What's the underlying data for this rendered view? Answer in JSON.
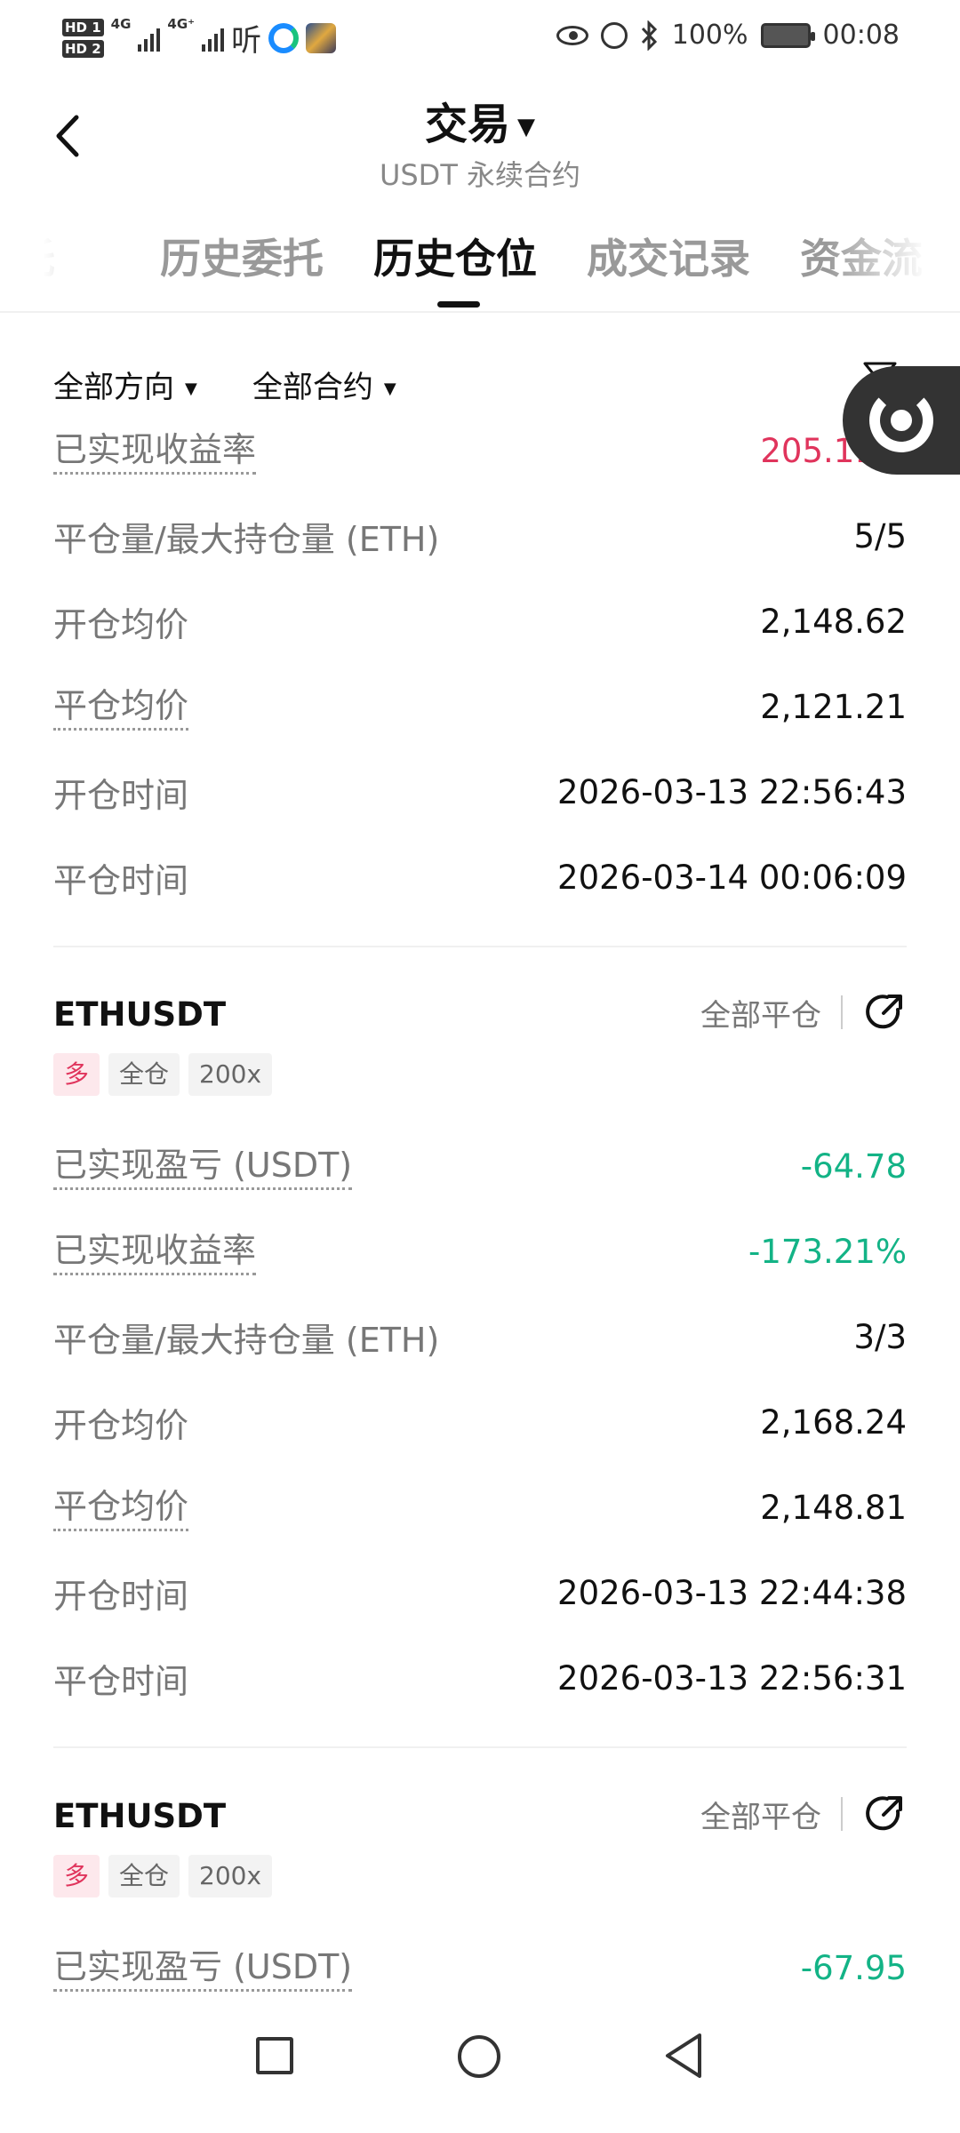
{
  "status_bar": {
    "hd1": "HD 1",
    "hd2": "HD 2",
    "net1": "4G",
    "net2": "4G⁺",
    "app_text": "听",
    "battery_pct": "100%",
    "time": "00:08"
  },
  "header": {
    "title": "交易",
    "subtitle": "USDT 永续合约"
  },
  "tabs": [
    {
      "label": "委托"
    },
    {
      "label": "历史委托"
    },
    {
      "label": "历史仓位",
      "active": true
    },
    {
      "label": "成交记录"
    },
    {
      "label": "资金流"
    }
  ],
  "filters": {
    "direction": "全部方向",
    "contract": "全部合约"
  },
  "card0": {
    "rows": [
      {
        "label": "已实现收益率",
        "value": "205.11%"
      },
      {
        "label": "平仓量/最大持仓量 (ETH)",
        "value": "5/5"
      },
      {
        "label": "开仓均价",
        "value": "2,148.62"
      },
      {
        "label": "平仓均价",
        "value": "2,121.21"
      },
      {
        "label": "开仓时间",
        "value": "2026-03-13 22:56:43"
      },
      {
        "label": "平仓时间",
        "value": "2026-03-14 00:06:09"
      }
    ]
  },
  "card1": {
    "symbol": "ETHUSDT",
    "close_all": "全部平仓",
    "tags": [
      "多",
      "全仓",
      "200x"
    ],
    "rows": [
      {
        "label": "已实现盈亏 (USDT)",
        "value": "-64.78"
      },
      {
        "label": "已实现收益率",
        "value": "-173.21%"
      },
      {
        "label": "平仓量/最大持仓量 (ETH)",
        "value": "3/3"
      },
      {
        "label": "开仓均价",
        "value": "2,168.24"
      },
      {
        "label": "平仓均价",
        "value": "2,148.81"
      },
      {
        "label": "开仓时间",
        "value": "2026-03-13 22:44:38"
      },
      {
        "label": "平仓时间",
        "value": "2026-03-13 22:56:31"
      }
    ]
  },
  "card2": {
    "symbol": "ETHUSDT",
    "close_all": "全部平仓",
    "tags": [
      "多",
      "全仓",
      "200x"
    ],
    "rows": [
      {
        "label": "已实现盈亏 (USDT)",
        "value": "-67.95"
      }
    ]
  },
  "colors": {
    "profit_red": "#e0345c",
    "loss_green": "#13b386",
    "text_primary": "#111111",
    "text_secondary": "#777777"
  },
  "icons": [
    "back-chevron-icon",
    "caret-down-icon",
    "filter-icon",
    "share-icon",
    "eye-icon",
    "alarm-icon",
    "bluetooth-icon",
    "battery-icon",
    "nav-recent-icon",
    "nav-home-icon",
    "nav-back-icon"
  ]
}
